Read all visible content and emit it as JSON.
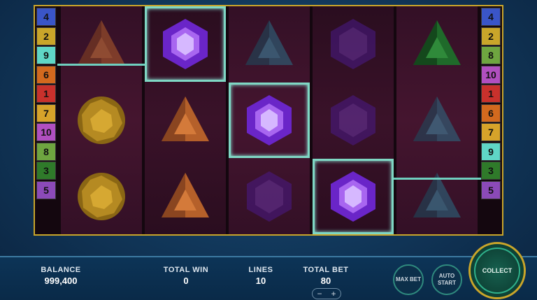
{
  "left_lines": [
    {
      "label": "4",
      "color": "#3a55c8"
    },
    {
      "label": "2",
      "color": "#c9a52a"
    },
    {
      "label": "9",
      "color": "#5fd6c6"
    },
    {
      "label": "6",
      "color": "#d2691e"
    },
    {
      "label": "1",
      "color": "#c8312c"
    },
    {
      "label": "7",
      "color": "#d6a32a"
    },
    {
      "label": "10",
      "color": "#b04fc0"
    },
    {
      "label": "8",
      "color": "#6ea540"
    },
    {
      "label": "3",
      "color": "#2f7a2a"
    },
    {
      "label": "5",
      "color": "#8b4ab8"
    }
  ],
  "right_lines": [
    {
      "label": "4",
      "color": "#3a55c8"
    },
    {
      "label": "2",
      "color": "#c9a52a"
    },
    {
      "label": "8",
      "color": "#6ea540"
    },
    {
      "label": "10",
      "color": "#b04fc0"
    },
    {
      "label": "1",
      "color": "#c8312c"
    },
    {
      "label": "6",
      "color": "#d2691e"
    },
    {
      "label": "7",
      "color": "#d6a32a"
    },
    {
      "label": "9",
      "color": "#5fd6c6"
    },
    {
      "label": "3",
      "color": "#2f7a2a"
    },
    {
      "label": "5",
      "color": "#8b4ab8"
    }
  ],
  "reels": [
    [
      "orange-triangle-gem-icon",
      "yellow-round-gem-icon",
      "yellow-round-gem-icon"
    ],
    [
      "purple-hexagon-gem-icon",
      "orange-triangle-gem-icon",
      "orange-triangle-gem-icon"
    ],
    [
      "blue-triangle-gem-icon",
      "purple-hexagon-gem-icon",
      "purple-hexagon-gem-icon"
    ],
    [
      "purple-hexagon-gem-icon",
      "purple-hexagon-gem-icon",
      "purple-hexagon-gem-icon"
    ],
    [
      "green-triangle-gem-icon",
      "blue-triangle-gem-icon",
      "blue-triangle-gem-icon"
    ]
  ],
  "winning_line": 9,
  "hud": {
    "balance_label": "BALANCE",
    "balance": "999,400",
    "total_win_label": "TOTAL WIN",
    "total_win": "0",
    "lines_label": "LINES",
    "lines": "10",
    "total_bet_label": "TOTAL BET",
    "total_bet": "80",
    "minus": "−",
    "plus": "+",
    "max_bet": "MAX BET",
    "auto_start": "AUTO START",
    "collect": "COLLECT"
  },
  "colors": {
    "frame": "#c9a52a",
    "win_line": "#6fd0bf",
    "accent": "#2fb08a"
  }
}
